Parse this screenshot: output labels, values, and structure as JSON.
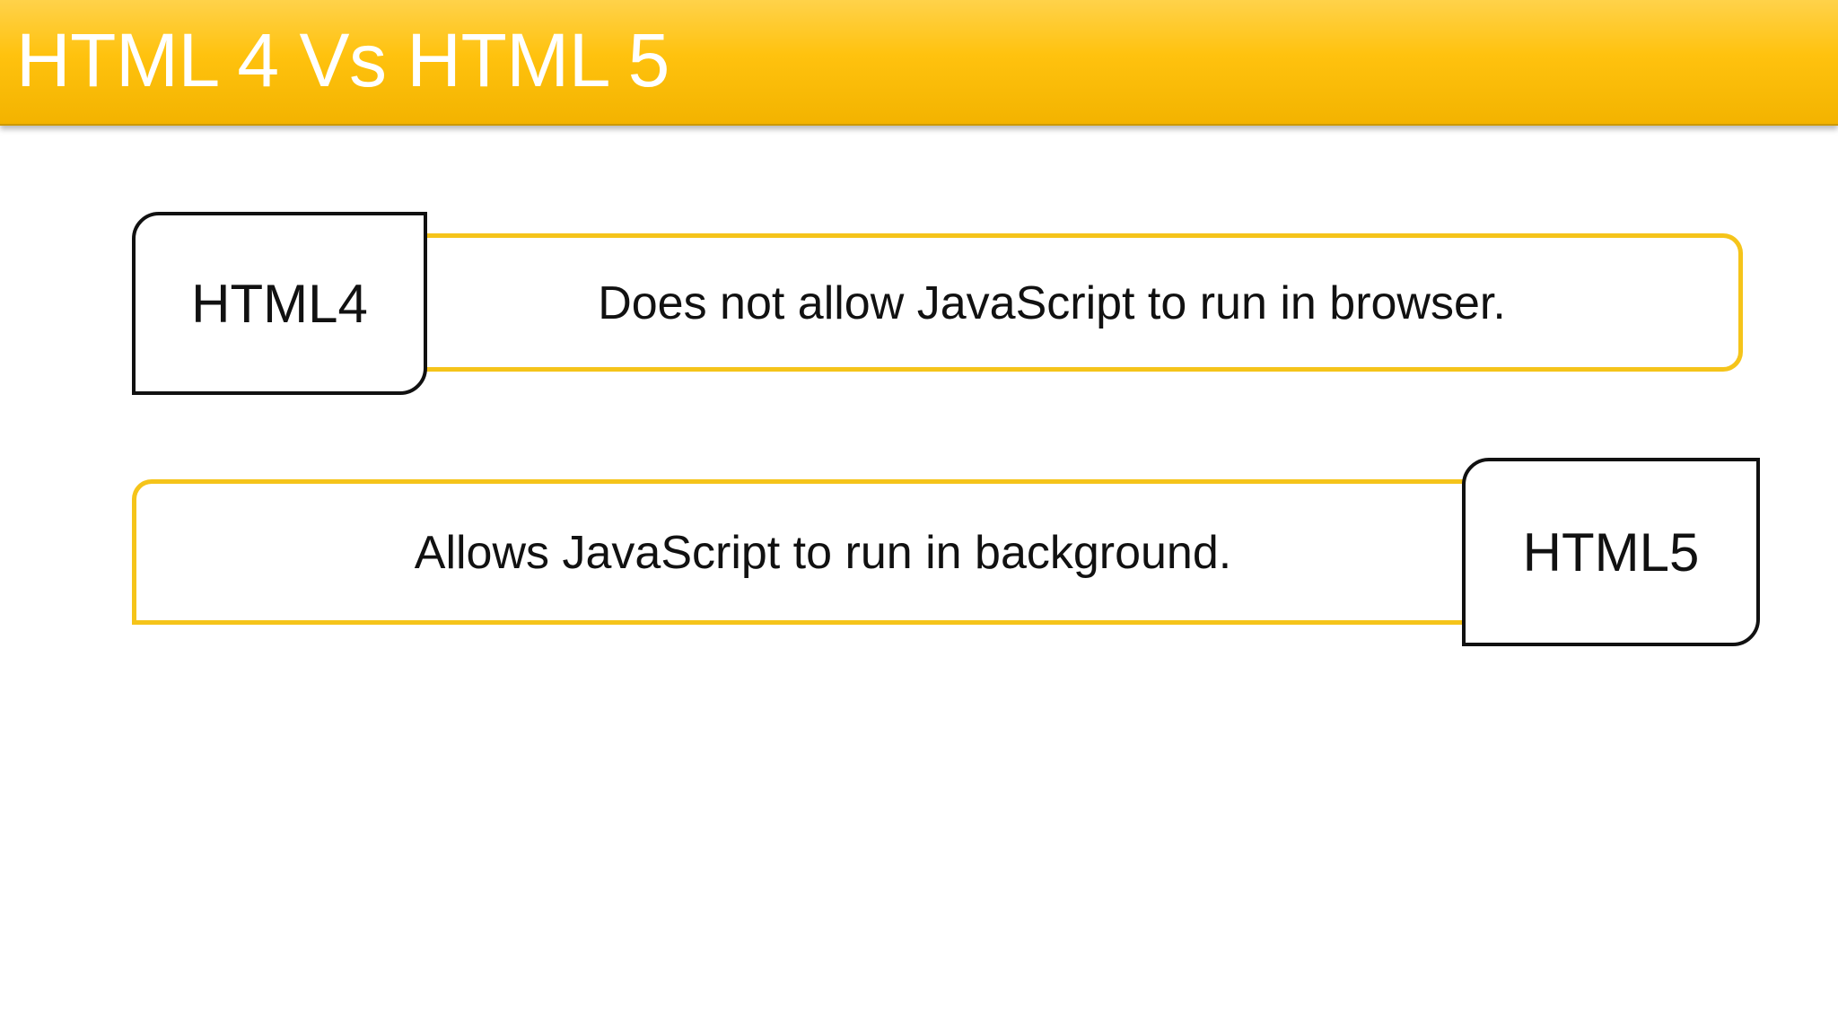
{
  "slide": {
    "title": "HTML 4 Vs HTML 5"
  },
  "rows": [
    {
      "label": "HTML4",
      "description": "Does not allow JavaScript to run in browser."
    },
    {
      "label": "HTML5",
      "description": "Allows JavaScript to run in background."
    }
  ],
  "colors": {
    "header": "#ffc20e",
    "accent_border": "#f5c41a",
    "label_border": "#111111",
    "title_text": "#ffffff"
  }
}
